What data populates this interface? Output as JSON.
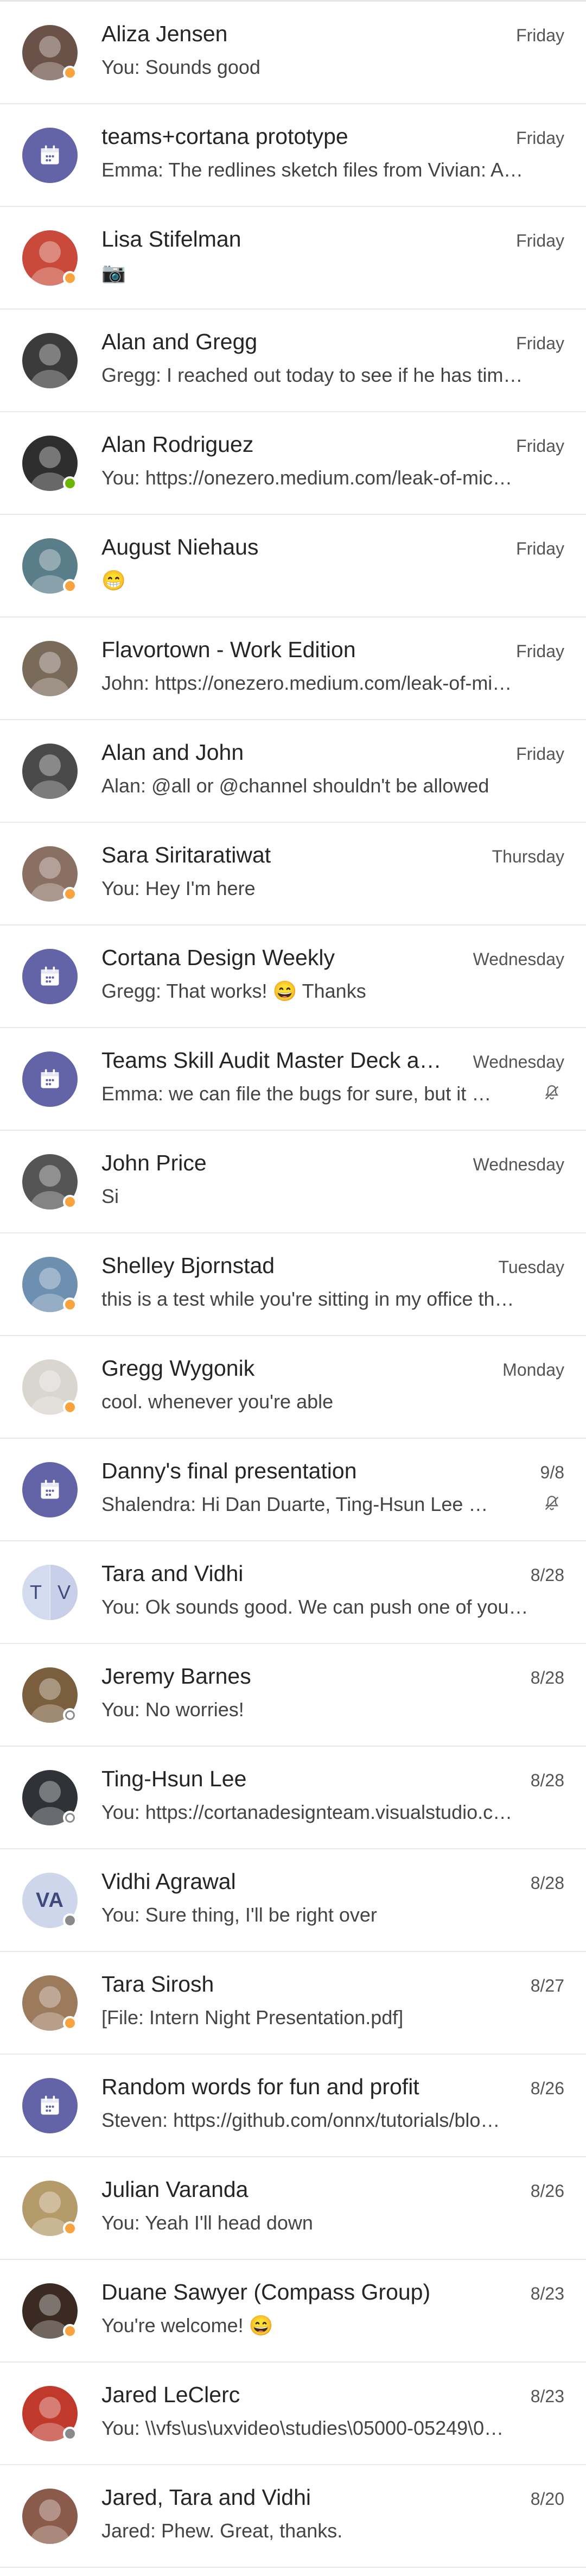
{
  "chats": [
    {
      "name": "Aliza Jensen",
      "time": "Friday",
      "preview": "You: Sounds good",
      "avatar": {
        "type": "photo",
        "color": "#6b5248"
      },
      "presence": "away"
    },
    {
      "name": "teams+cortana prototype",
      "time": "Friday",
      "preview": "Emma: The redlines sketch files from Vivian:  A…",
      "avatar": {
        "type": "meeting"
      },
      "presence": "none"
    },
    {
      "name": "Lisa Stifelman",
      "time": "Friday",
      "preview": "📷",
      "avatar": {
        "type": "photo",
        "color": "#c94a3a"
      },
      "presence": "away",
      "preview_icon": "camera-icon"
    },
    {
      "name": "Alan and Gregg",
      "time": "Friday",
      "preview": "Gregg: I reached out today to see if he has tim…",
      "avatar": {
        "type": "photo",
        "color": "#3b3b3b"
      },
      "presence": "none"
    },
    {
      "name": "Alan Rodriguez",
      "time": "Friday",
      "preview": "You: https://onezero.medium.com/leak-of-mic…",
      "avatar": {
        "type": "photo",
        "color": "#2e2e2e"
      },
      "presence": "available"
    },
    {
      "name": "August Niehaus",
      "time": "Friday",
      "preview": "😁",
      "avatar": {
        "type": "photo",
        "color": "#5a7d8a"
      },
      "presence": "away"
    },
    {
      "name": "Flavortown - Work Edition",
      "time": "Friday",
      "preview": "John: https://onezero.medium.com/leak-of-mi…",
      "avatar": {
        "type": "photo",
        "color": "#7a6a5a"
      },
      "presence": "none"
    },
    {
      "name": "Alan and John",
      "time": "Friday",
      "preview": "Alan: @all or @channel shouldn't be allowed",
      "avatar": {
        "type": "photo",
        "color": "#4a4a4a"
      },
      "presence": "none"
    },
    {
      "name": "Sara Siritaratiwat",
      "time": "Thursday",
      "preview": "You: Hey I'm here",
      "avatar": {
        "type": "photo",
        "color": "#8a6f63"
      },
      "presence": "away"
    },
    {
      "name": "Cortana Design Weekly",
      "time": "Wednesday",
      "preview": "Gregg: That works! 😄 Thanks",
      "avatar": {
        "type": "meeting"
      },
      "presence": "none"
    },
    {
      "name": "Teams Skill Audit Master Deck an…",
      "time": "Wednesday",
      "preview": "Emma: we can file the bugs for sure, but it s…",
      "avatar": {
        "type": "meeting"
      },
      "presence": "none",
      "muted": true
    },
    {
      "name": "John Price",
      "time": "Wednesday",
      "preview": "Si",
      "avatar": {
        "type": "photo",
        "color": "#555555"
      },
      "presence": "away"
    },
    {
      "name": "Shelley Bjornstad",
      "time": "Tuesday",
      "preview": "this is a test while you're sitting in my office th…",
      "avatar": {
        "type": "photo",
        "color": "#6d8fb0"
      },
      "presence": "away"
    },
    {
      "name": "Gregg Wygonik",
      "time": "Monday",
      "preview": "cool. whenever you're able",
      "avatar": {
        "type": "photo",
        "color": "#d9d5cf"
      },
      "presence": "away"
    },
    {
      "name": "Danny's final presentation",
      "time": "9/8",
      "preview": "Shalendra: Hi Dan Duarte,  Ting-Hsun Lee co…",
      "avatar": {
        "type": "meeting"
      },
      "presence": "none",
      "muted": true
    },
    {
      "name": "Tara and Vidhi",
      "time": "8/28",
      "preview": "You: Ok sounds good. We can push one of your…",
      "avatar": {
        "type": "split",
        "left": "T",
        "right": "V"
      },
      "presence": "none"
    },
    {
      "name": "Jeremy Barnes",
      "time": "8/28",
      "preview": "You: No worries!",
      "avatar": {
        "type": "photo",
        "color": "#7a5e3e"
      },
      "presence": "offline"
    },
    {
      "name": "Ting-Hsun Lee",
      "time": "8/28",
      "preview": "You: https://cortanadesignteam.visualstudio.c…",
      "avatar": {
        "type": "photo",
        "color": "#2f3338"
      },
      "presence": "offline"
    },
    {
      "name": "Vidhi Agrawal",
      "time": "8/28",
      "preview": "You: Sure thing, I'll be right over",
      "avatar": {
        "type": "initials",
        "text": "VA"
      },
      "presence": "dnd-gray"
    },
    {
      "name": "Tara Sirosh",
      "time": "8/27",
      "preview": "[File: Intern Night Presentation.pdf]",
      "avatar": {
        "type": "photo",
        "color": "#9c7a5c"
      },
      "presence": "away"
    },
    {
      "name": "Random words for fun and profit",
      "time": "8/26",
      "preview": "Steven: https://github.com/onnx/tutorials/blo…",
      "avatar": {
        "type": "meeting"
      },
      "presence": "none"
    },
    {
      "name": "Julian Varanda",
      "time": "8/26",
      "preview": "You: Yeah I'll head down",
      "avatar": {
        "type": "photo",
        "color": "#b59a6a"
      },
      "presence": "away"
    },
    {
      "name": "Duane Sawyer (Compass Group)",
      "time": "8/23",
      "preview": "You're welcome! 😄",
      "avatar": {
        "type": "photo",
        "color": "#3a2a22"
      },
      "presence": "away"
    },
    {
      "name": "Jared LeClerc",
      "time": "8/23",
      "preview": "You: \\\\vfs\\us\\uxvideo\\studies\\05000-05249\\0…",
      "avatar": {
        "type": "photo",
        "color": "#c0392b"
      },
      "presence": "dnd-gray"
    },
    {
      "name": "Jared, Tara and Vidhi",
      "time": "8/20",
      "preview": "Jared: Phew. Great, thanks.",
      "avatar": {
        "type": "photo",
        "color": "#8a5a4a"
      },
      "presence": "none"
    }
  ]
}
